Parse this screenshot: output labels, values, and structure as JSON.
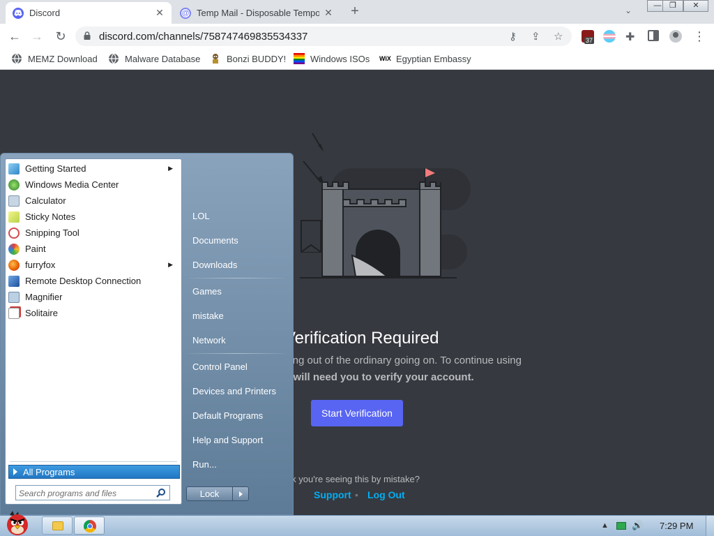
{
  "browser": {
    "tabs": [
      {
        "title": "Discord",
        "favicon_color": "#5865f2",
        "active": true
      },
      {
        "title": "Temp Mail - Disposable Tempo",
        "favicon_color": "#7c84f0",
        "active": false
      }
    ],
    "new_tab": "+",
    "tab_menu": "⌄",
    "window_controls": {
      "minimize": "—",
      "restore": "❐",
      "close": "✕"
    },
    "nav": {
      "back": "←",
      "forward": "→",
      "reload": "↻"
    },
    "url": "discord.com/channels/758747469835534337",
    "omnibox_icons": {
      "key": "⚷",
      "share": "⇪",
      "star": "☆"
    },
    "extension_badge": "37",
    "menu": "⋮",
    "bookmarks": [
      {
        "label": "MEMZ Download",
        "icon": "globe-icon"
      },
      {
        "label": "Malware Database",
        "icon": "globe-icon"
      },
      {
        "label": "Bonzi BUDDY!",
        "icon": "bonzi-icon"
      },
      {
        "label": "Windows ISOs",
        "icon": "rainbow-flag-icon"
      },
      {
        "label": "Egyptian Embassy",
        "icon": "wix-icon"
      }
    ],
    "wix_label": "WiX"
  },
  "discord": {
    "title": "Verification Required",
    "description_line1": "hing out of the ordinary going on. To continue using",
    "description_line2": "e will need you to verify your account.",
    "start_button": "Start Verification",
    "mistake_text": "ink you're seeing this by mistake?",
    "support_link": "Support",
    "separator": "•",
    "logout_link": "Log Out",
    "colors": {
      "background": "#36393f",
      "brand": "#5865f2",
      "link": "#00aff4"
    }
  },
  "start_menu": {
    "programs": [
      {
        "label": "Getting Started",
        "submenu": true,
        "icon_color": "#4aa8e0"
      },
      {
        "label": "Windows Media Center",
        "submenu": false,
        "icon_color": "#3c9a3c"
      },
      {
        "label": "Calculator",
        "submenu": false,
        "icon_color": "#7d97b0"
      },
      {
        "label": "Sticky Notes",
        "submenu": false,
        "icon_color": "#d7e05a"
      },
      {
        "label": "Snipping Tool",
        "submenu": false,
        "icon_color": "#d24a4a"
      },
      {
        "label": "Paint",
        "submenu": false,
        "icon_color": "#5a9ad6"
      },
      {
        "label": "furryfox",
        "submenu": true,
        "icon_color": "#e66000"
      },
      {
        "label": "Remote Desktop Connection",
        "submenu": false,
        "icon_color": "#2d6cc0"
      },
      {
        "label": "Magnifier",
        "submenu": false,
        "icon_color": "#6d8ba8"
      },
      {
        "label": "Solitaire",
        "submenu": false,
        "icon_color": "#c83c3c"
      }
    ],
    "all_programs": "All Programs",
    "search_placeholder": "Search programs and files",
    "right_links": [
      {
        "label": "LOL",
        "group": 1
      },
      {
        "label": "Documents",
        "group": 1
      },
      {
        "label": "Downloads",
        "group": 1
      },
      {
        "label": "Games",
        "group": 2
      },
      {
        "label": "mistake",
        "group": 2
      },
      {
        "label": "Network",
        "group": 2
      },
      {
        "label": "Control Panel",
        "group": 3
      },
      {
        "label": "Devices and Printers",
        "group": 3
      },
      {
        "label": "Default Programs",
        "group": 3
      },
      {
        "label": "Help and Support",
        "group": 3
      },
      {
        "label": "Run...",
        "group": 3
      }
    ],
    "lock_button": "Lock"
  },
  "taskbar": {
    "clock": "7:29 PM",
    "tray_chevron": "▲",
    "volume": "🔊"
  }
}
